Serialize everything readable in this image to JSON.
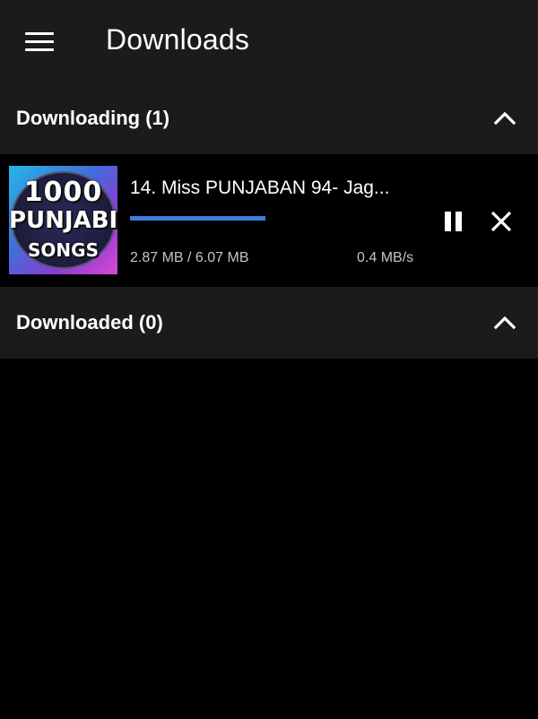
{
  "app_bar": {
    "menu_icon": "hamburger-menu-icon",
    "title": "Downloads",
    "background": "#1b1b1b"
  },
  "sections": {
    "downloading": {
      "label": "Downloading (1)",
      "icon": "chevron-up-icon",
      "expanded": true
    },
    "downloaded": {
      "label": "Downloaded (0)",
      "icon": "chevron-up-icon",
      "expanded": true
    }
  },
  "downloads": [
    {
      "thumbnail": {
        "lines": [
          "1000",
          "PUNJABI",
          "SONGS"
        ]
      },
      "title": "14. Miss PUNJABAN 94- Jag...",
      "progress_fraction": 0.473,
      "progress_color": "#3d7bdc",
      "size": "2.87 MB / 6.07 MB",
      "speed": "0.4 MB/s",
      "pause_icon": "pause-icon",
      "cancel_icon": "close-icon"
    }
  ],
  "colors": {
    "background": "#000000",
    "header": "#1b1b1b",
    "accent": "#3d7bdc",
    "text": "#ffffff",
    "secondary_text": "#c4c4c4"
  }
}
